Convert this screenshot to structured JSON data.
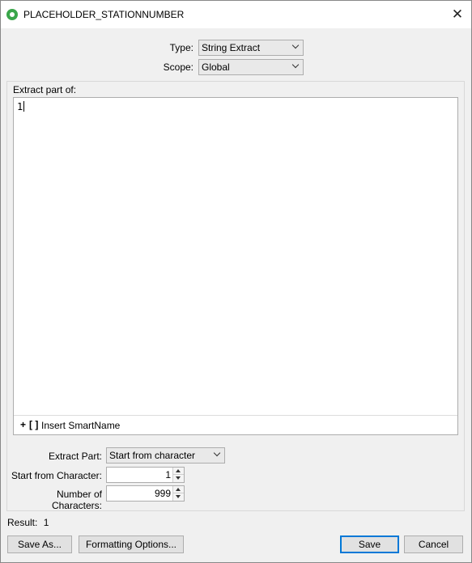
{
  "window": {
    "title": "PLACEHOLDER_STATIONNUMBER",
    "close_glyph": "✕"
  },
  "type_row": {
    "label": "Type:",
    "value": "String Extract"
  },
  "scope_row": {
    "label": "Scope:",
    "value": "Global"
  },
  "extract_group": {
    "label": "Extract part of:",
    "text_value": "1",
    "insert_plus": "+",
    "insert_brackets": "[ ]",
    "insert_label": "Insert SmartName"
  },
  "extract_part": {
    "label": "Extract Part:",
    "value": "Start from character"
  },
  "start_from": {
    "label": "Start from Character:",
    "value": "1"
  },
  "num_chars": {
    "label": "Number of Characters:",
    "value": "999"
  },
  "result": {
    "label": "Result:",
    "value": "1"
  },
  "buttons": {
    "save_as": "Save As...",
    "formatting": "Formatting Options...",
    "save": "Save",
    "cancel": "Cancel"
  },
  "colors": {
    "accent": "#0078d7",
    "title_icon": "#3aa64a"
  }
}
